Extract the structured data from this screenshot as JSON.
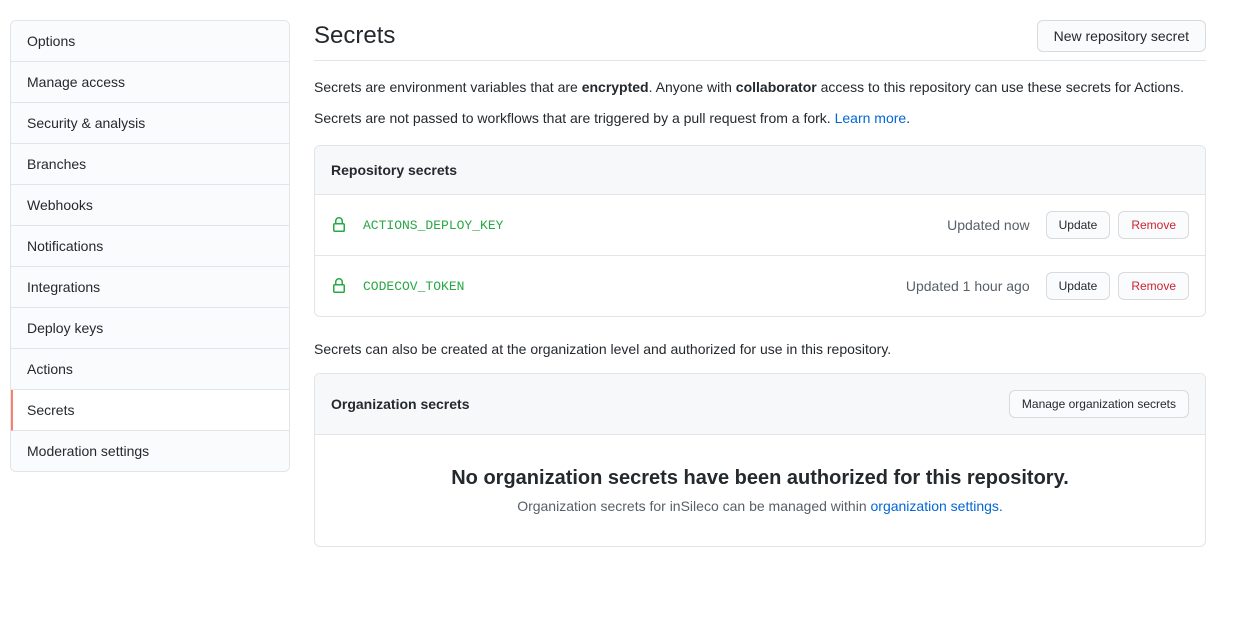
{
  "sidebar": {
    "items": [
      {
        "label": "Options",
        "selected": false
      },
      {
        "label": "Manage access",
        "selected": false
      },
      {
        "label": "Security & analysis",
        "selected": false
      },
      {
        "label": "Branches",
        "selected": false
      },
      {
        "label": "Webhooks",
        "selected": false
      },
      {
        "label": "Notifications",
        "selected": false
      },
      {
        "label": "Integrations",
        "selected": false
      },
      {
        "label": "Deploy keys",
        "selected": false
      },
      {
        "label": "Actions",
        "selected": false
      },
      {
        "label": "Secrets",
        "selected": true
      },
      {
        "label": "Moderation settings",
        "selected": false
      }
    ]
  },
  "header": {
    "title": "Secrets",
    "new_button": "New repository secret"
  },
  "intro": {
    "part1": "Secrets are environment variables that are ",
    "encrypted": "encrypted",
    "part2": ". Anyone with ",
    "collaborator": "collaborator",
    "part3": " access to this repository can use these secrets for Actions.",
    "line2_pre": "Secrets are not passed to workflows that are triggered by a pull request from a fork. ",
    "learn_more": "Learn more",
    "line2_post": "."
  },
  "repo_secrets": {
    "heading": "Repository secrets",
    "rows": [
      {
        "name": "ACTIONS_DEPLOY_KEY",
        "updated": "Updated now",
        "update": "Update",
        "remove": "Remove"
      },
      {
        "name": "CODECOV_TOKEN",
        "updated": "Updated 1 hour ago",
        "update": "Update",
        "remove": "Remove"
      }
    ]
  },
  "org_intro": "Secrets can also be created at the organization level and authorized for use in this repository.",
  "org_secrets": {
    "heading": "Organization secrets",
    "manage_button": "Manage organization secrets",
    "empty_title": "No organization secrets have been authorized for this repository.",
    "empty_text_pre": "Organization secrets for inSileco can be managed within ",
    "empty_link": "organization settings."
  }
}
